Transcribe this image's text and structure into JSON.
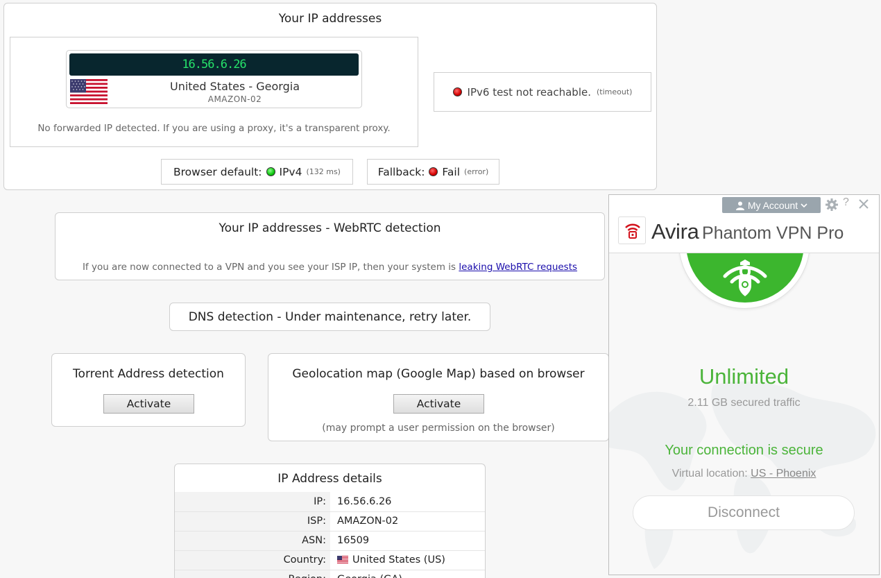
{
  "ip_section": {
    "title": "Your IP addresses",
    "ipv4": "16.56.6.26",
    "location": "United States - Georgia",
    "isp": "AMAZON-02",
    "forward_note": "No forwarded IP detected. If you are using a proxy, it's a transparent proxy.",
    "ipv6_text": "IPv6 test not reachable.",
    "ipv6_detail": "(timeout)",
    "browser_default_label": "Browser default:",
    "browser_default_value": "IPv4",
    "browser_default_detail": "(132 ms)",
    "fallback_label": "Fallback:",
    "fallback_value": "Fail",
    "fallback_detail": "(error)"
  },
  "webrtc": {
    "title": "Your IP addresses - WebRTC detection",
    "note": "If you are now connected to a VPN and you see your ISP IP, then your system is ",
    "link": "leaking WebRTC requests"
  },
  "dns": {
    "text": "DNS detection - Under maintenance, retry later."
  },
  "torrent": {
    "title": "Torrent Address detection",
    "button": "Activate"
  },
  "geolocation": {
    "title": "Geolocation map (Google Map) based on browser",
    "button": "Activate",
    "note": "(may prompt a user permission on the browser)"
  },
  "details": {
    "title": "IP Address details",
    "rows": [
      {
        "key": "IP:",
        "value": "16.56.6.26"
      },
      {
        "key": "ISP:",
        "value": "AMAZON-02"
      },
      {
        "key": "ASN:",
        "value": "16509"
      },
      {
        "key": "Country:",
        "value": "United States (US)"
      },
      {
        "key": "Region:",
        "value": "Georgia (GA)"
      }
    ]
  },
  "vpn": {
    "account_label": "My Account",
    "help_label": "?",
    "brand_name": "Avira",
    "product_name": "Phantom VPN Pro",
    "plan": "Unlimited",
    "traffic": "2.11 GB secured traffic",
    "status": "Your connection is secure",
    "virtual_location_label": "Virtual location:",
    "virtual_location_value": "US - Phoenix",
    "disconnect_label": "Disconnect"
  },
  "colors": {
    "vpn_green": "#3cb62e",
    "ip_display_bg": "#08262e",
    "ip_display_text": "#26e26a",
    "avira_red": "#d3121c"
  }
}
